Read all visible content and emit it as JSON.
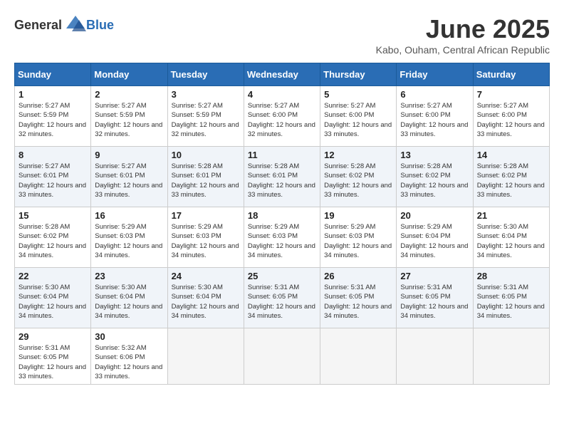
{
  "logo": {
    "general": "General",
    "blue": "Blue"
  },
  "title": "June 2025",
  "subtitle": "Kabo, Ouham, Central African Republic",
  "days": [
    "Sunday",
    "Monday",
    "Tuesday",
    "Wednesday",
    "Thursday",
    "Friday",
    "Saturday"
  ],
  "weeks": [
    [
      {
        "num": "1",
        "sunrise": "5:27 AM",
        "sunset": "5:59 PM",
        "daylight": "12 hours and 32 minutes."
      },
      {
        "num": "2",
        "sunrise": "5:27 AM",
        "sunset": "5:59 PM",
        "daylight": "12 hours and 32 minutes."
      },
      {
        "num": "3",
        "sunrise": "5:27 AM",
        "sunset": "5:59 PM",
        "daylight": "12 hours and 32 minutes."
      },
      {
        "num": "4",
        "sunrise": "5:27 AM",
        "sunset": "6:00 PM",
        "daylight": "12 hours and 32 minutes."
      },
      {
        "num": "5",
        "sunrise": "5:27 AM",
        "sunset": "6:00 PM",
        "daylight": "12 hours and 33 minutes."
      },
      {
        "num": "6",
        "sunrise": "5:27 AM",
        "sunset": "6:00 PM",
        "daylight": "12 hours and 33 minutes."
      },
      {
        "num": "7",
        "sunrise": "5:27 AM",
        "sunset": "6:00 PM",
        "daylight": "12 hours and 33 minutes."
      }
    ],
    [
      {
        "num": "8",
        "sunrise": "5:27 AM",
        "sunset": "6:01 PM",
        "daylight": "12 hours and 33 minutes."
      },
      {
        "num": "9",
        "sunrise": "5:27 AM",
        "sunset": "6:01 PM",
        "daylight": "12 hours and 33 minutes."
      },
      {
        "num": "10",
        "sunrise": "5:28 AM",
        "sunset": "6:01 PM",
        "daylight": "12 hours and 33 minutes."
      },
      {
        "num": "11",
        "sunrise": "5:28 AM",
        "sunset": "6:01 PM",
        "daylight": "12 hours and 33 minutes."
      },
      {
        "num": "12",
        "sunrise": "5:28 AM",
        "sunset": "6:02 PM",
        "daylight": "12 hours and 33 minutes."
      },
      {
        "num": "13",
        "sunrise": "5:28 AM",
        "sunset": "6:02 PM",
        "daylight": "12 hours and 33 minutes."
      },
      {
        "num": "14",
        "sunrise": "5:28 AM",
        "sunset": "6:02 PM",
        "daylight": "12 hours and 33 minutes."
      }
    ],
    [
      {
        "num": "15",
        "sunrise": "5:28 AM",
        "sunset": "6:02 PM",
        "daylight": "12 hours and 34 minutes."
      },
      {
        "num": "16",
        "sunrise": "5:29 AM",
        "sunset": "6:03 PM",
        "daylight": "12 hours and 34 minutes."
      },
      {
        "num": "17",
        "sunrise": "5:29 AM",
        "sunset": "6:03 PM",
        "daylight": "12 hours and 34 minutes."
      },
      {
        "num": "18",
        "sunrise": "5:29 AM",
        "sunset": "6:03 PM",
        "daylight": "12 hours and 34 minutes."
      },
      {
        "num": "19",
        "sunrise": "5:29 AM",
        "sunset": "6:03 PM",
        "daylight": "12 hours and 34 minutes."
      },
      {
        "num": "20",
        "sunrise": "5:29 AM",
        "sunset": "6:04 PM",
        "daylight": "12 hours and 34 minutes."
      },
      {
        "num": "21",
        "sunrise": "5:30 AM",
        "sunset": "6:04 PM",
        "daylight": "12 hours and 34 minutes."
      }
    ],
    [
      {
        "num": "22",
        "sunrise": "5:30 AM",
        "sunset": "6:04 PM",
        "daylight": "12 hours and 34 minutes."
      },
      {
        "num": "23",
        "sunrise": "5:30 AM",
        "sunset": "6:04 PM",
        "daylight": "12 hours and 34 minutes."
      },
      {
        "num": "24",
        "sunrise": "5:30 AM",
        "sunset": "6:04 PM",
        "daylight": "12 hours and 34 minutes."
      },
      {
        "num": "25",
        "sunrise": "5:31 AM",
        "sunset": "6:05 PM",
        "daylight": "12 hours and 34 minutes."
      },
      {
        "num": "26",
        "sunrise": "5:31 AM",
        "sunset": "6:05 PM",
        "daylight": "12 hours and 34 minutes."
      },
      {
        "num": "27",
        "sunrise": "5:31 AM",
        "sunset": "6:05 PM",
        "daylight": "12 hours and 34 minutes."
      },
      {
        "num": "28",
        "sunrise": "5:31 AM",
        "sunset": "6:05 PM",
        "daylight": "12 hours and 34 minutes."
      }
    ],
    [
      {
        "num": "29",
        "sunrise": "5:31 AM",
        "sunset": "6:05 PM",
        "daylight": "12 hours and 33 minutes."
      },
      {
        "num": "30",
        "sunrise": "5:32 AM",
        "sunset": "6:06 PM",
        "daylight": "12 hours and 33 minutes."
      },
      null,
      null,
      null,
      null,
      null
    ]
  ]
}
